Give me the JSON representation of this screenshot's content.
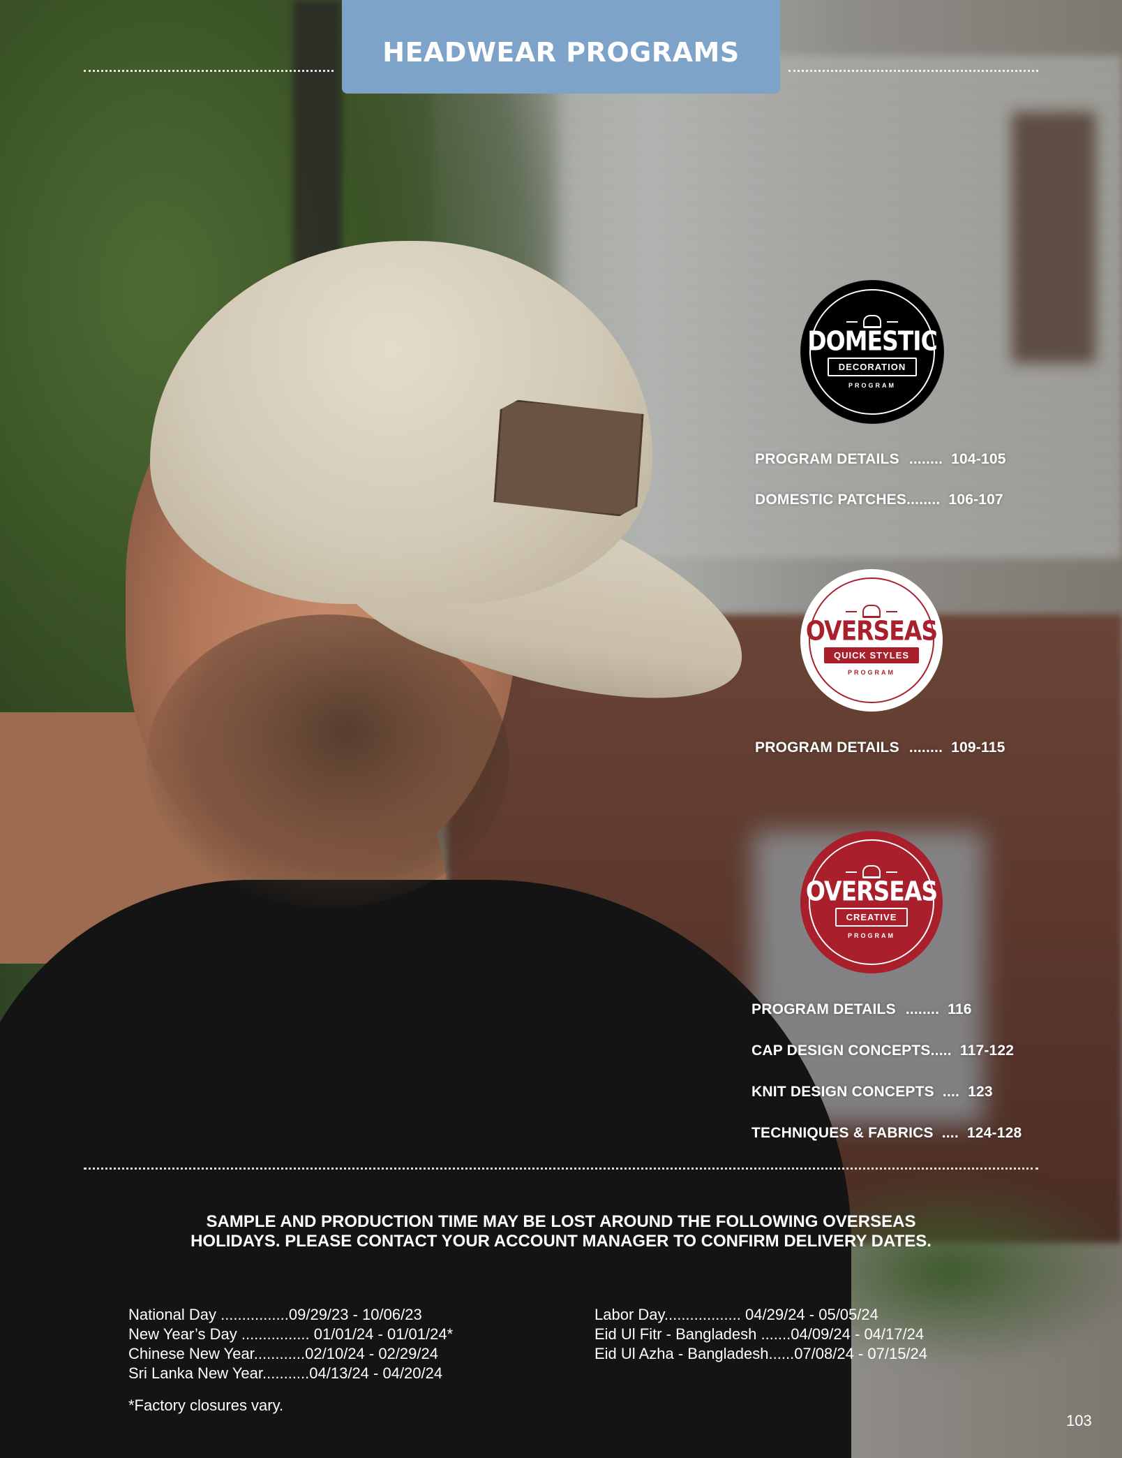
{
  "header": {
    "title": "HEADWEAR PROGRAMS"
  },
  "domestic": {
    "badge": {
      "word": "DOMESTIC",
      "ribbon": "DECORATION",
      "program": "PROGRAM"
    },
    "toc": [
      {
        "label": "PROGRAM DETAILS",
        "dots": "........",
        "pages": "104-105"
      },
      {
        "label": "DOMESTIC PATCHES",
        "dots": "........",
        "pages": "106-107"
      }
    ]
  },
  "quick_styles": {
    "badge": {
      "word": "OVERSEAS",
      "ribbon": "QUICK STYLES",
      "program": "PROGRAM"
    },
    "toc": [
      {
        "label": "PROGRAM DETAILS",
        "dots": "........",
        "pages": "109-115"
      }
    ]
  },
  "creative": {
    "badge": {
      "word": "OVERSEAS",
      "ribbon": "CREATIVE",
      "program": "PROGRAM"
    },
    "toc": [
      {
        "label": "PROGRAM DETAILS",
        "dots": "........",
        "pages": "116"
      },
      {
        "label": "CAP DESIGN CONCEPTS",
        "dots": ".....",
        "pages": "117-122"
      },
      {
        "label": "KNIT DESIGN CONCEPTS",
        "dots": "....",
        "pages": "123"
      },
      {
        "label": "TECHNIQUES & FABRICS",
        "dots": "....",
        "pages": "124-128"
      }
    ]
  },
  "notice": {
    "line1": "SAMPLE AND PRODUCTION TIME MAY BE LOST AROUND THE FOLLOWING OVERSEAS",
    "line2": "HOLIDAYS. PLEASE CONTACT YOUR ACCOUNT MANAGER TO CONFIRM DELIVERY DATES."
  },
  "holidays_left": [
    {
      "name": "National Day",
      "dots": "................",
      "dates": "09/29/23 - 10/06/23",
      "mark": ""
    },
    {
      "name": "New Year’s Day",
      "dots": "................",
      "dates": "01/01/24 - 01/01/24",
      "mark": "*"
    },
    {
      "name": "Chinese New Year",
      "dots": "............",
      "dates": "02/10/24 - 02/29/24",
      "mark": ""
    },
    {
      "name": "Sri Lanka New Year",
      "dots": "...........",
      "dates": "04/13/24 - 04/20/24",
      "mark": ""
    }
  ],
  "holidays_right": [
    {
      "name": "Labor Day",
      "dots": "..................",
      "dates": "04/29/24 - 05/05/24"
    },
    {
      "name": "Eid Ul Fitr - Bangladesh",
      "dots": ".......",
      "dates": "04/09/24 - 04/17/24"
    },
    {
      "name": "Eid Ul Azha - Bangladesh",
      "dots": "......",
      "dates": "07/08/24 - 07/15/24"
    }
  ],
  "footnote": "*Factory closures vary.",
  "page_number": "103"
}
